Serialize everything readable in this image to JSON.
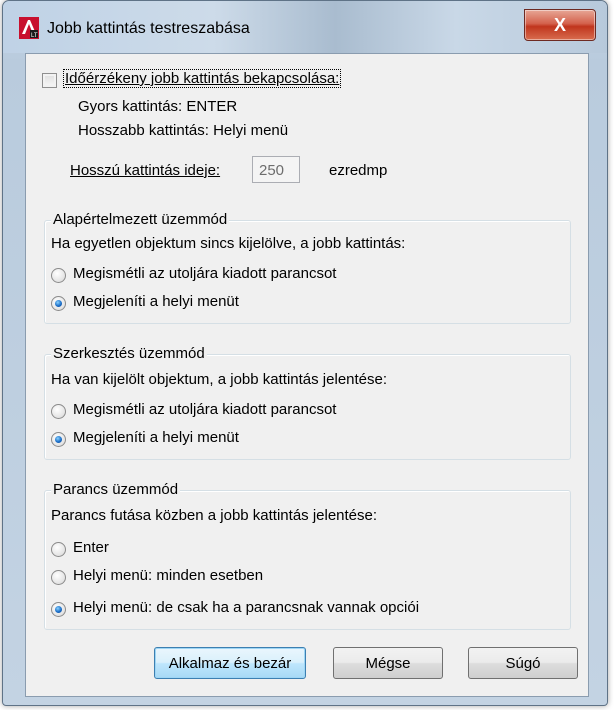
{
  "window": {
    "title": "Jobb kattintás testreszabása",
    "close_label": "X"
  },
  "timesensitive": {
    "checkbox_label": "Időérzékeny jobb kattintás bekapcsolása:",
    "checked": false,
    "quick_click": "Gyors kattintás: ENTER",
    "long_click": "Hosszabb kattintás: Helyi menü",
    "duration_label": "Hosszú kattintás ideje:",
    "duration_value": "250",
    "unit": "ezredmp"
  },
  "default_mode": {
    "legend": "Alapértelmezett üzemmód",
    "description": "Ha egyetlen objektum sincs kijelölve, a jobb kattintás:",
    "options": [
      {
        "label": "Megismétli az utoljára kiadott parancsot",
        "checked": false
      },
      {
        "label": "Megjeleníti a helyi menüt",
        "checked": true
      }
    ]
  },
  "edit_mode": {
    "legend": "Szerkesztés üzemmód",
    "description": "Ha van kijelölt objektum, a jobb kattintás jelentése:",
    "options": [
      {
        "label": "Megismétli az utoljára kiadott parancsot",
        "checked": false
      },
      {
        "label": "Megjeleníti a helyi menüt",
        "checked": true
      }
    ]
  },
  "command_mode": {
    "legend": "Parancs üzemmód",
    "description": "Parancs futása közben a jobb kattintás jelentése:",
    "options": [
      {
        "label": "Enter",
        "checked": false
      },
      {
        "label": "Helyi menü: minden esetben",
        "checked": false
      },
      {
        "label": "Helyi menü: de csak ha a parancsnak vannak opciói",
        "checked": true
      }
    ]
  },
  "buttons": {
    "apply": "Alkalmaz és bezár",
    "cancel": "Mégse",
    "help": "Súgó"
  },
  "colors": {
    "accent": "#1b6fc8",
    "close_button": "#c0351d",
    "dialog_face": "#f0f0f0"
  }
}
